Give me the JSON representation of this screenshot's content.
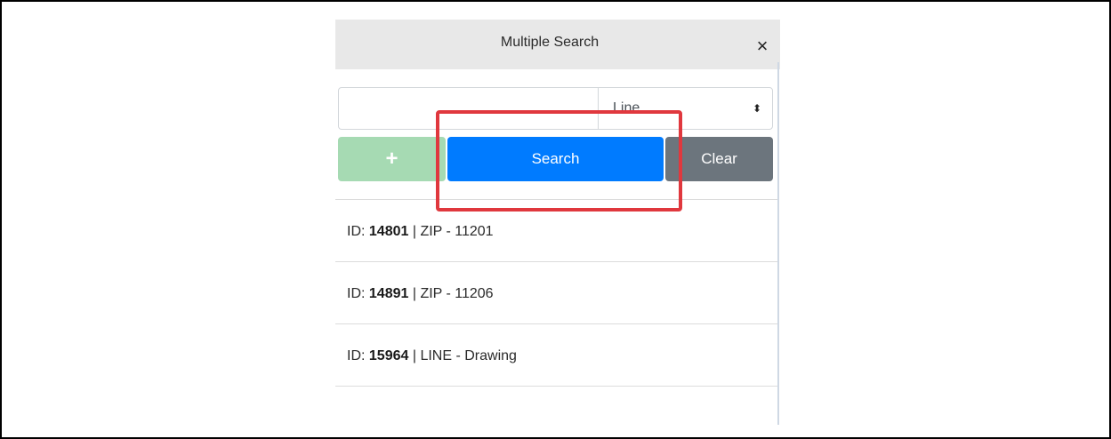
{
  "dialog": {
    "title": "Multiple Search",
    "close_glyph": "×"
  },
  "search": {
    "input_value": "",
    "select_value": "Line",
    "select_arrow": "⬍"
  },
  "buttons": {
    "add_label": "+",
    "search_label": "Search",
    "clear_label": "Clear"
  },
  "results": [
    {
      "id_prefix": "ID: ",
      "id": "14801",
      "separator": " | ",
      "detail": "ZIP - 11201"
    },
    {
      "id_prefix": "ID: ",
      "id": "14891",
      "separator": " | ",
      "detail": "ZIP - 11206"
    },
    {
      "id_prefix": "ID: ",
      "id": "15964",
      "separator": " | ",
      "detail": "LINE - Drawing"
    }
  ],
  "colors": {
    "header_bg": "#e8e8e8",
    "add_button": "#a6dab3",
    "search_button": "#007bff",
    "clear_button": "#6c757d",
    "highlight_box": "#e0383e"
  }
}
